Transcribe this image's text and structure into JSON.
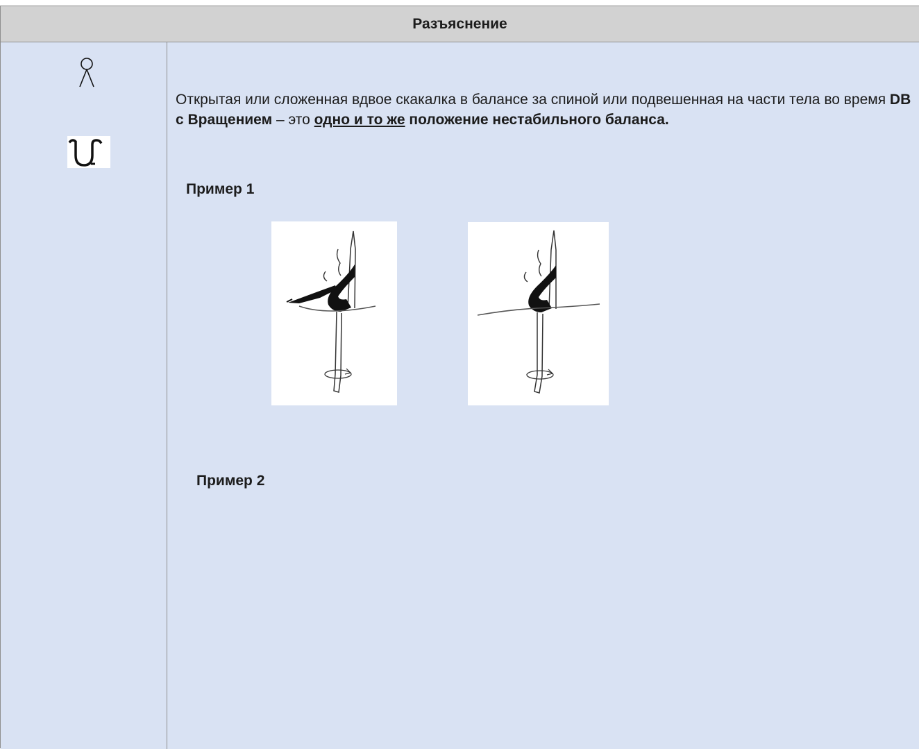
{
  "header": {
    "title": "Разъяснение"
  },
  "icons": {
    "person": "body-difficulty-symbol-icon",
    "rope": "rope-symbol-icon"
  },
  "explanation": {
    "part1": "Открытая или сложенная вдвое скакалка в балансе за спиной или подвешенная на части тела во время ",
    "bold1": "DB с Вращением",
    "part2": " – это ",
    "underlined": "одно и то же",
    "bold2": " положение нестабильного баланса."
  },
  "examples": {
    "example1_label": "Пример 1",
    "example2_label": "Пример 2"
  },
  "colors": {
    "header_bg": "#d2d2d2",
    "body_bg": "#d9e2f3",
    "border": "#8e8e8e"
  }
}
